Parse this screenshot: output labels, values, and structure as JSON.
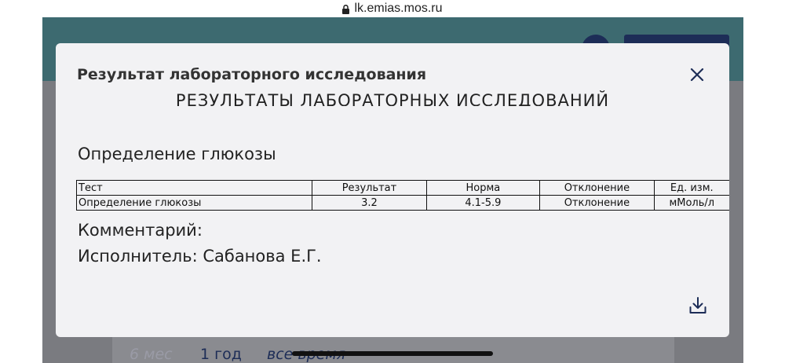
{
  "browser": {
    "url": "lk.emias.mos.ru"
  },
  "background": {
    "periods": [
      "6 мес",
      "1 год",
      "все время"
    ]
  },
  "modal": {
    "title": "Результат лабораторного исследования",
    "report_heading": "РЕЗУЛЬТАТЫ ЛАБОРАТОРНЫХ ИССЛЕДОВАНИЙ",
    "test_name": "Определение глюкозы",
    "table": {
      "headers": [
        "Тест",
        "Результат",
        "Норма",
        "Отклонение",
        "Ед. изм."
      ],
      "rows": [
        [
          "Определение глюкозы",
          "3.2",
          "4.1-5.9",
          "Отклонение",
          "мМоль/л"
        ]
      ]
    },
    "comment": "Комментарий:",
    "performer": "Исполнитель: Сабанова Е.Г."
  },
  "colors": {
    "header": "#3d6a70",
    "accent": "#1d2d57",
    "modal_bg": "#f2f2f4"
  },
  "icons": {
    "close": "close-icon",
    "download": "download-icon",
    "lock": "lock-icon"
  }
}
